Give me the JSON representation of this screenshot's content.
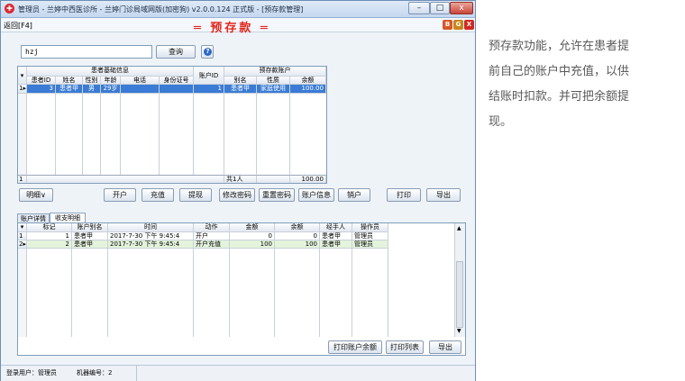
{
  "window": {
    "title": "管理员 - 兰婷中西医诊所 - 兰婷门诊局域网版(加密狗) v2.0.0.124 正式版 - [预存款管理]",
    "minimize": "–",
    "maximize": "□",
    "close": "x"
  },
  "menubar": {
    "back": "返回[F4]",
    "banner": "═ 预存款 ═",
    "mini_buttons": [
      "B",
      "G",
      "X"
    ]
  },
  "search": {
    "value": "hzj",
    "button": "查询",
    "help": "?"
  },
  "patients_grid": {
    "group_headers": {
      "patient_info": "患者基础信息",
      "account_id": "账户ID",
      "prepaid_account": "预存款账户"
    },
    "columns": [
      "患者ID",
      "姓名",
      "性别",
      "年龄",
      "电话",
      "身份证号",
      "账户ID",
      "别名",
      "性质",
      "余额"
    ],
    "rows": [
      {
        "row_no": "1",
        "marker": "▸",
        "patient_id": "3",
        "name": "患者甲",
        "gender": "男",
        "age": "29岁",
        "phone": "",
        "id_card": "",
        "account_id": "1",
        "alias": "患者甲",
        "nature": "家庭使用",
        "balance": "100.00"
      }
    ],
    "footer": {
      "row_no": "1",
      "count": "共1人",
      "balance_total": "100.00"
    }
  },
  "actions": {
    "detail": "明细∨",
    "open_account": "开户",
    "recharge": "充值",
    "withdraw": "提现",
    "change_password": "修改密码",
    "reset_password": "重置密码",
    "account_info": "账户信息",
    "close_account": "销户",
    "print": "打印",
    "export": "导出"
  },
  "tabs": [
    "账户详情",
    "收支明细"
  ],
  "transactions": {
    "columns": [
      "标记",
      "账户别名",
      "时间",
      "动作",
      "金额",
      "余额",
      "经手人",
      "操作员"
    ],
    "rows": [
      {
        "row_no": "1",
        "marker": "",
        "mark": "1",
        "alias": "患者甲",
        "time": "2017-7-30 下午 9:45:4",
        "action": "开户",
        "amount": "0",
        "balance": "0",
        "handler": "患者甲",
        "operator": "管理员"
      },
      {
        "row_no": "2",
        "marker": "▸",
        "mark": "2",
        "alias": "患者甲",
        "time": "2017-7-30 下午 9:45:4",
        "action": "开户充值",
        "amount": "100",
        "balance": "100",
        "handler": "患者甲",
        "operator": "管理员"
      }
    ],
    "print_balance": "打印账户余额",
    "print_list": "打印列表",
    "export": "导出"
  },
  "statusbar": {
    "user": "登录用户：管理员",
    "machine": "机器编号：2"
  },
  "caption": [
    "预存款功能，允许在患者提",
    "前自己的账户中充值，以供",
    "结账时扣款。并可把余额提",
    "现。"
  ],
  "colors": {
    "banner": "#e3261b",
    "selection": "#3a7bd5",
    "highlight_row": "#e4f4dc"
  }
}
